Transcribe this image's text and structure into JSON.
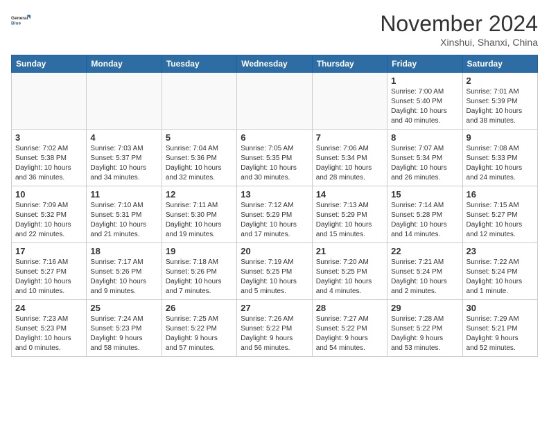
{
  "header": {
    "logo_general": "General",
    "logo_blue": "Blue",
    "month_title": "November 2024",
    "location": "Xinshui, Shanxi, China"
  },
  "calendar": {
    "days_of_week": [
      "Sunday",
      "Monday",
      "Tuesday",
      "Wednesday",
      "Thursday",
      "Friday",
      "Saturday"
    ],
    "weeks": [
      [
        {
          "day": "",
          "info": ""
        },
        {
          "day": "",
          "info": ""
        },
        {
          "day": "",
          "info": ""
        },
        {
          "day": "",
          "info": ""
        },
        {
          "day": "",
          "info": ""
        },
        {
          "day": "1",
          "info": "Sunrise: 7:00 AM\nSunset: 5:40 PM\nDaylight: 10 hours\nand 40 minutes."
        },
        {
          "day": "2",
          "info": "Sunrise: 7:01 AM\nSunset: 5:39 PM\nDaylight: 10 hours\nand 38 minutes."
        }
      ],
      [
        {
          "day": "3",
          "info": "Sunrise: 7:02 AM\nSunset: 5:38 PM\nDaylight: 10 hours\nand 36 minutes."
        },
        {
          "day": "4",
          "info": "Sunrise: 7:03 AM\nSunset: 5:37 PM\nDaylight: 10 hours\nand 34 minutes."
        },
        {
          "day": "5",
          "info": "Sunrise: 7:04 AM\nSunset: 5:36 PM\nDaylight: 10 hours\nand 32 minutes."
        },
        {
          "day": "6",
          "info": "Sunrise: 7:05 AM\nSunset: 5:35 PM\nDaylight: 10 hours\nand 30 minutes."
        },
        {
          "day": "7",
          "info": "Sunrise: 7:06 AM\nSunset: 5:34 PM\nDaylight: 10 hours\nand 28 minutes."
        },
        {
          "day": "8",
          "info": "Sunrise: 7:07 AM\nSunset: 5:34 PM\nDaylight: 10 hours\nand 26 minutes."
        },
        {
          "day": "9",
          "info": "Sunrise: 7:08 AM\nSunset: 5:33 PM\nDaylight: 10 hours\nand 24 minutes."
        }
      ],
      [
        {
          "day": "10",
          "info": "Sunrise: 7:09 AM\nSunset: 5:32 PM\nDaylight: 10 hours\nand 22 minutes."
        },
        {
          "day": "11",
          "info": "Sunrise: 7:10 AM\nSunset: 5:31 PM\nDaylight: 10 hours\nand 21 minutes."
        },
        {
          "day": "12",
          "info": "Sunrise: 7:11 AM\nSunset: 5:30 PM\nDaylight: 10 hours\nand 19 minutes."
        },
        {
          "day": "13",
          "info": "Sunrise: 7:12 AM\nSunset: 5:29 PM\nDaylight: 10 hours\nand 17 minutes."
        },
        {
          "day": "14",
          "info": "Sunrise: 7:13 AM\nSunset: 5:29 PM\nDaylight: 10 hours\nand 15 minutes."
        },
        {
          "day": "15",
          "info": "Sunrise: 7:14 AM\nSunset: 5:28 PM\nDaylight: 10 hours\nand 14 minutes."
        },
        {
          "day": "16",
          "info": "Sunrise: 7:15 AM\nSunset: 5:27 PM\nDaylight: 10 hours\nand 12 minutes."
        }
      ],
      [
        {
          "day": "17",
          "info": "Sunrise: 7:16 AM\nSunset: 5:27 PM\nDaylight: 10 hours\nand 10 minutes."
        },
        {
          "day": "18",
          "info": "Sunrise: 7:17 AM\nSunset: 5:26 PM\nDaylight: 10 hours\nand 9 minutes."
        },
        {
          "day": "19",
          "info": "Sunrise: 7:18 AM\nSunset: 5:26 PM\nDaylight: 10 hours\nand 7 minutes."
        },
        {
          "day": "20",
          "info": "Sunrise: 7:19 AM\nSunset: 5:25 PM\nDaylight: 10 hours\nand 5 minutes."
        },
        {
          "day": "21",
          "info": "Sunrise: 7:20 AM\nSunset: 5:25 PM\nDaylight: 10 hours\nand 4 minutes."
        },
        {
          "day": "22",
          "info": "Sunrise: 7:21 AM\nSunset: 5:24 PM\nDaylight: 10 hours\nand 2 minutes."
        },
        {
          "day": "23",
          "info": "Sunrise: 7:22 AM\nSunset: 5:24 PM\nDaylight: 10 hours\nand 1 minute."
        }
      ],
      [
        {
          "day": "24",
          "info": "Sunrise: 7:23 AM\nSunset: 5:23 PM\nDaylight: 10 hours\nand 0 minutes."
        },
        {
          "day": "25",
          "info": "Sunrise: 7:24 AM\nSunset: 5:23 PM\nDaylight: 9 hours\nand 58 minutes."
        },
        {
          "day": "26",
          "info": "Sunrise: 7:25 AM\nSunset: 5:22 PM\nDaylight: 9 hours\nand 57 minutes."
        },
        {
          "day": "27",
          "info": "Sunrise: 7:26 AM\nSunset: 5:22 PM\nDaylight: 9 hours\nand 56 minutes."
        },
        {
          "day": "28",
          "info": "Sunrise: 7:27 AM\nSunset: 5:22 PM\nDaylight: 9 hours\nand 54 minutes."
        },
        {
          "day": "29",
          "info": "Sunrise: 7:28 AM\nSunset: 5:22 PM\nDaylight: 9 hours\nand 53 minutes."
        },
        {
          "day": "30",
          "info": "Sunrise: 7:29 AM\nSunset: 5:21 PM\nDaylight: 9 hours\nand 52 minutes."
        }
      ]
    ]
  }
}
